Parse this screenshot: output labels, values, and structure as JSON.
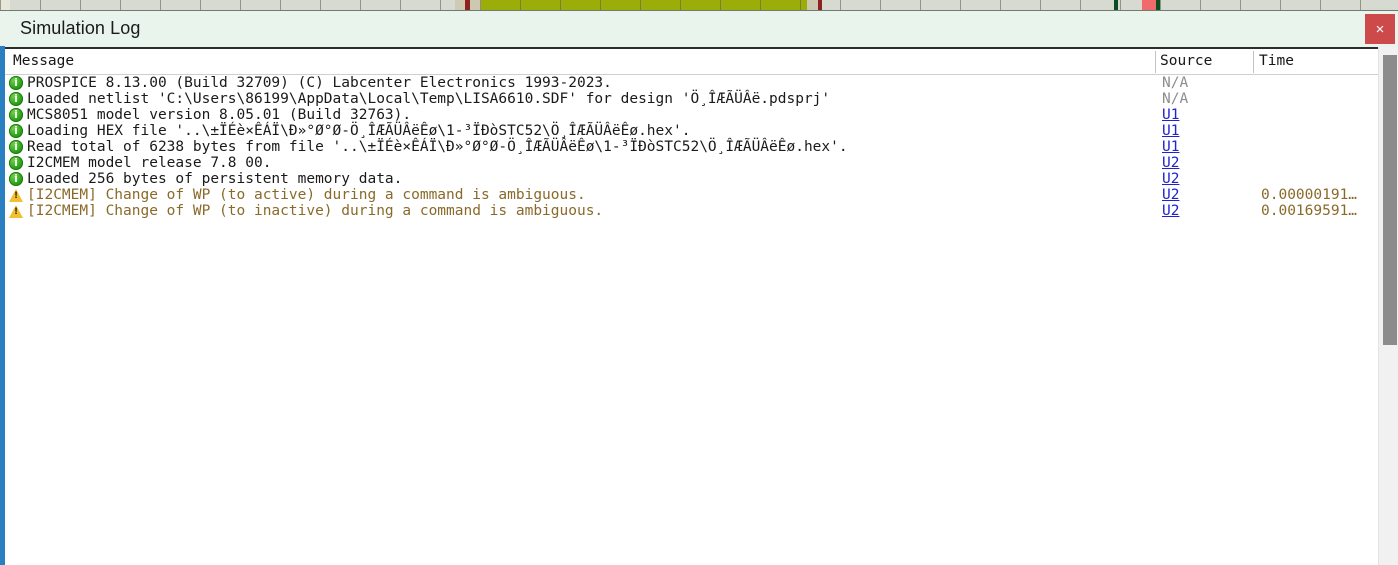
{
  "window": {
    "title": "Simulation Log",
    "close_label": "×",
    "accent_color": "#2a7fc1",
    "titlebar_color": "#e9f5ec",
    "close_color": "#cc4a4a"
  },
  "columns": {
    "message": "Message",
    "source": "Source",
    "time": "Time"
  },
  "rows": [
    {
      "icon": "info-icon",
      "severity": "info",
      "message": "PROSPICE 8.13.00 (Build 32709) (C) Labcenter Electronics 1993-2023.",
      "source": "N/A",
      "source_kind": "text",
      "time": ""
    },
    {
      "icon": "info-icon",
      "severity": "info",
      "message": "Loaded netlist 'C:\\Users\\86199\\AppData\\Local\\Temp\\LISA6610.SDF' for design 'Ö¸ÎÆÃÜÂë.pdsprj'",
      "source": "N/A",
      "source_kind": "text",
      "time": ""
    },
    {
      "icon": "info-icon",
      "severity": "info",
      "message": "MCS8051 model version 8.05.01 (Build 32763).",
      "source": "U1",
      "source_kind": "link",
      "time": ""
    },
    {
      "icon": "info-icon",
      "severity": "info",
      "message": "Loading HEX file '..\\±ÏÉè×ÊÁÏ\\Ð»°Ø°Ø-Ö¸ÎÆÃÜÂëÊø\\1-³ÏÐòSTC52\\Ö¸ÎÆÃÜÂëÊø.hex'.",
      "source": "U1",
      "source_kind": "link",
      "time": ""
    },
    {
      "icon": "info-icon",
      "severity": "info",
      "message": "Read total of 6238 bytes from file '..\\±ÏÉè×ÊÁÏ\\Ð»°Ø°Ø-Ö¸ÎÆÃÜÂëÊø\\1-³ÏÐòSTC52\\Ö¸ÎÆÃÜÂëÊø.hex'.",
      "source": "U1",
      "source_kind": "link",
      "time": ""
    },
    {
      "icon": "info-icon",
      "severity": "info",
      "message": "I2CMEM model release 7.8 00.",
      "source": "U2",
      "source_kind": "link",
      "time": ""
    },
    {
      "icon": "info-icon",
      "severity": "info",
      "message": "Loaded 256 bytes of persistent memory data.",
      "source": "U2",
      "source_kind": "link",
      "time": ""
    },
    {
      "icon": "warning-icon",
      "severity": "warning",
      "message": "[I2CMEM] Change of WP (to active) during a command is ambiguous.",
      "source": "U2",
      "source_kind": "link",
      "time": "0.00000191…"
    },
    {
      "icon": "warning-icon",
      "severity": "warning",
      "message": "[I2CMEM] Change of WP (to inactive) during a command is ambiguous.",
      "source": "U2",
      "source_kind": "link",
      "time": "0.00169591…"
    }
  ],
  "scrollbar": {
    "orientation": "vertical",
    "thumb_position_pct": 0
  }
}
